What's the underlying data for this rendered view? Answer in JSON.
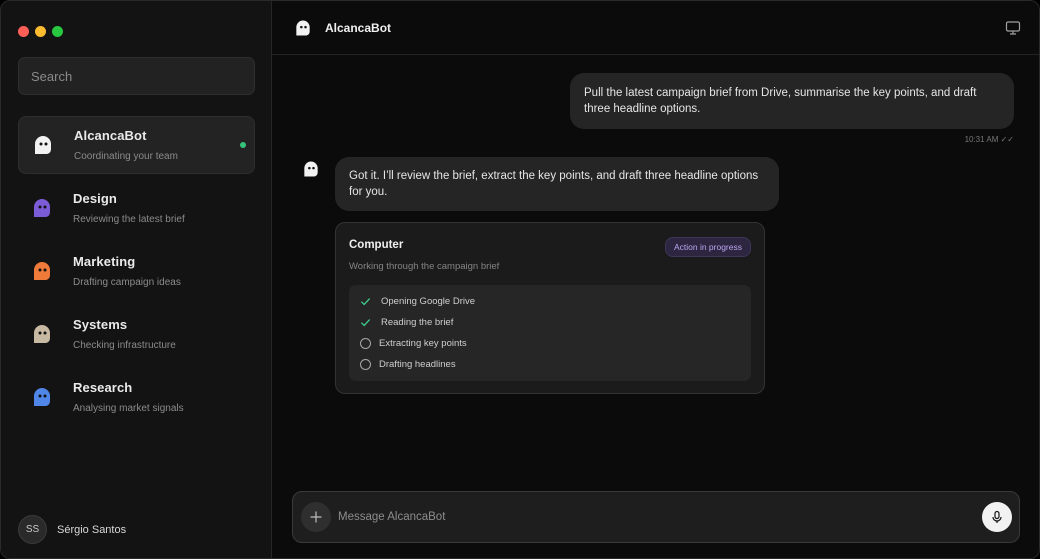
{
  "sidebar": {
    "search_placeholder": "Search",
    "agents": [
      {
        "name": "AlcancaBot",
        "status": "Coordinating your team",
        "color": "#f2f2f2",
        "online": true
      },
      {
        "name": "Design",
        "status": "Reviewing the latest brief",
        "color": "#7c5cd6"
      },
      {
        "name": "Marketing",
        "status": "Drafting campaign ideas",
        "color": "#ef7a3a"
      },
      {
        "name": "Systems",
        "status": "Checking infrastructure",
        "color": "#c8b9a2"
      },
      {
        "name": "Research",
        "status": "Analysing market signals",
        "color": "#4f86e8"
      }
    ],
    "user": {
      "initials": "SS",
      "name": "Sérgio Santos"
    }
  },
  "header": {
    "title": "AlcancaBot",
    "icon": "monitor-icon"
  },
  "messages": {
    "user_text": "Pull the latest campaign brief from Drive, summarise the key points, and draft three headline options.",
    "user_time": "10:31 AM ✓✓",
    "bot_text": "Got it. I’ll review the brief, extract the key points, and draft three headline options for you."
  },
  "card": {
    "title": "Computer",
    "badge": "Action in progress",
    "subtitle": "Working through the campaign brief",
    "steps": [
      {
        "label": "Opening Google Drive",
        "done": true
      },
      {
        "label": "Reading the brief",
        "done": true
      },
      {
        "label": "Extracting key points",
        "done": false
      },
      {
        "label": "Drafting headlines",
        "done": false
      }
    ]
  },
  "composer": {
    "placeholder": "Message AlcancaBot"
  },
  "colors": {
    "accent_green": "#34c47a",
    "badge_text": "#b9a7f0"
  }
}
